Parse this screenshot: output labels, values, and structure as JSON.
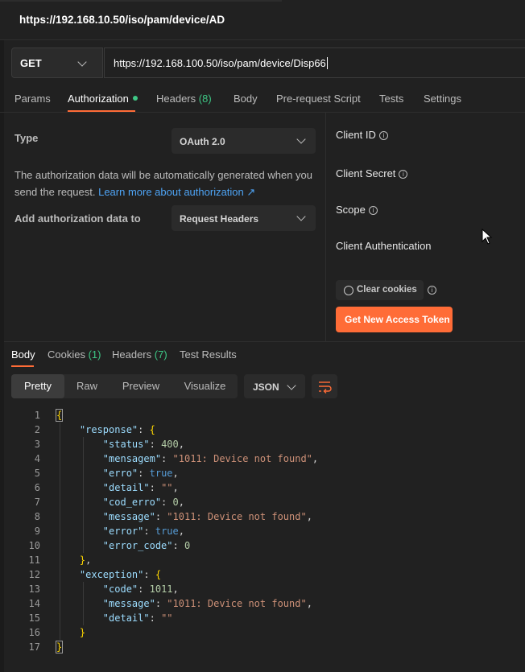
{
  "window": {
    "title": "https://192.168.10.50/iso/pam/device/AD"
  },
  "request": {
    "method": "GET",
    "url": "https://192.168.100.50/iso/pam/device/Disp66"
  },
  "request_tabs": [
    {
      "label": "Params"
    },
    {
      "label": "Authorization"
    },
    {
      "label": "Headers",
      "count": "(8)"
    },
    {
      "label": "Body"
    },
    {
      "label": "Pre-request Script"
    },
    {
      "label": "Tests"
    },
    {
      "label": "Settings"
    }
  ],
  "auth": {
    "type_label": "Type",
    "type_value": "OAuth 2.0",
    "description": "The authorization data will be automatically generated when you send the request.",
    "learn_more": "Learn more about authorization ↗",
    "add_to_label": "Add authorization data to",
    "add_to_value": "Request Headers",
    "client_id_label": "Client ID",
    "client_secret_label": "Client Secret",
    "scope_label": "Scope",
    "client_auth_label": "Client Authentication",
    "clear_cookies": "Clear cookies",
    "get_token": "Get New Access Token"
  },
  "response_tabs": [
    {
      "label": "Body"
    },
    {
      "label": "Cookies",
      "count": "(1)"
    },
    {
      "label": "Headers",
      "count": "(7)"
    },
    {
      "label": "Test Results"
    }
  ],
  "view_modes": [
    "Pretty",
    "Raw",
    "Preview",
    "Visualize"
  ],
  "format": "JSON",
  "icons": {
    "chevron": "chevron-down-icon",
    "info": "info-icon",
    "cookie": "cookie-icon",
    "wrap": "wrap-lines-icon",
    "cursor": "mouse-pointer-icon"
  },
  "colors": {
    "accent": "#ff6c37",
    "count": "#3ec785",
    "link": "#4ea4f5"
  },
  "code_lines": [
    [
      "1",
      "{"
    ],
    [
      "2",
      "    \"response\": {"
    ],
    [
      "3",
      "        \"status\": 400,"
    ],
    [
      "4",
      "        \"mensagem\": \"1011: Device not found\","
    ],
    [
      "5",
      "        \"erro\": true,"
    ],
    [
      "6",
      "        \"detail\": \"\","
    ],
    [
      "7",
      "        \"cod_erro\": 0,"
    ],
    [
      "8",
      "        \"message\": \"1011: Device not found\","
    ],
    [
      "9",
      "        \"error\": true,"
    ],
    [
      "10",
      "        \"error_code\": 0"
    ],
    [
      "11",
      "    },"
    ],
    [
      "12",
      "    \"exception\": {"
    ],
    [
      "13",
      "        \"code\": 1011,"
    ],
    [
      "14",
      "        \"message\": \"1011: Device not found\","
    ],
    [
      "15",
      "        \"detail\": \"\""
    ],
    [
      "16",
      "    }"
    ],
    [
      "17",
      "}"
    ]
  ]
}
